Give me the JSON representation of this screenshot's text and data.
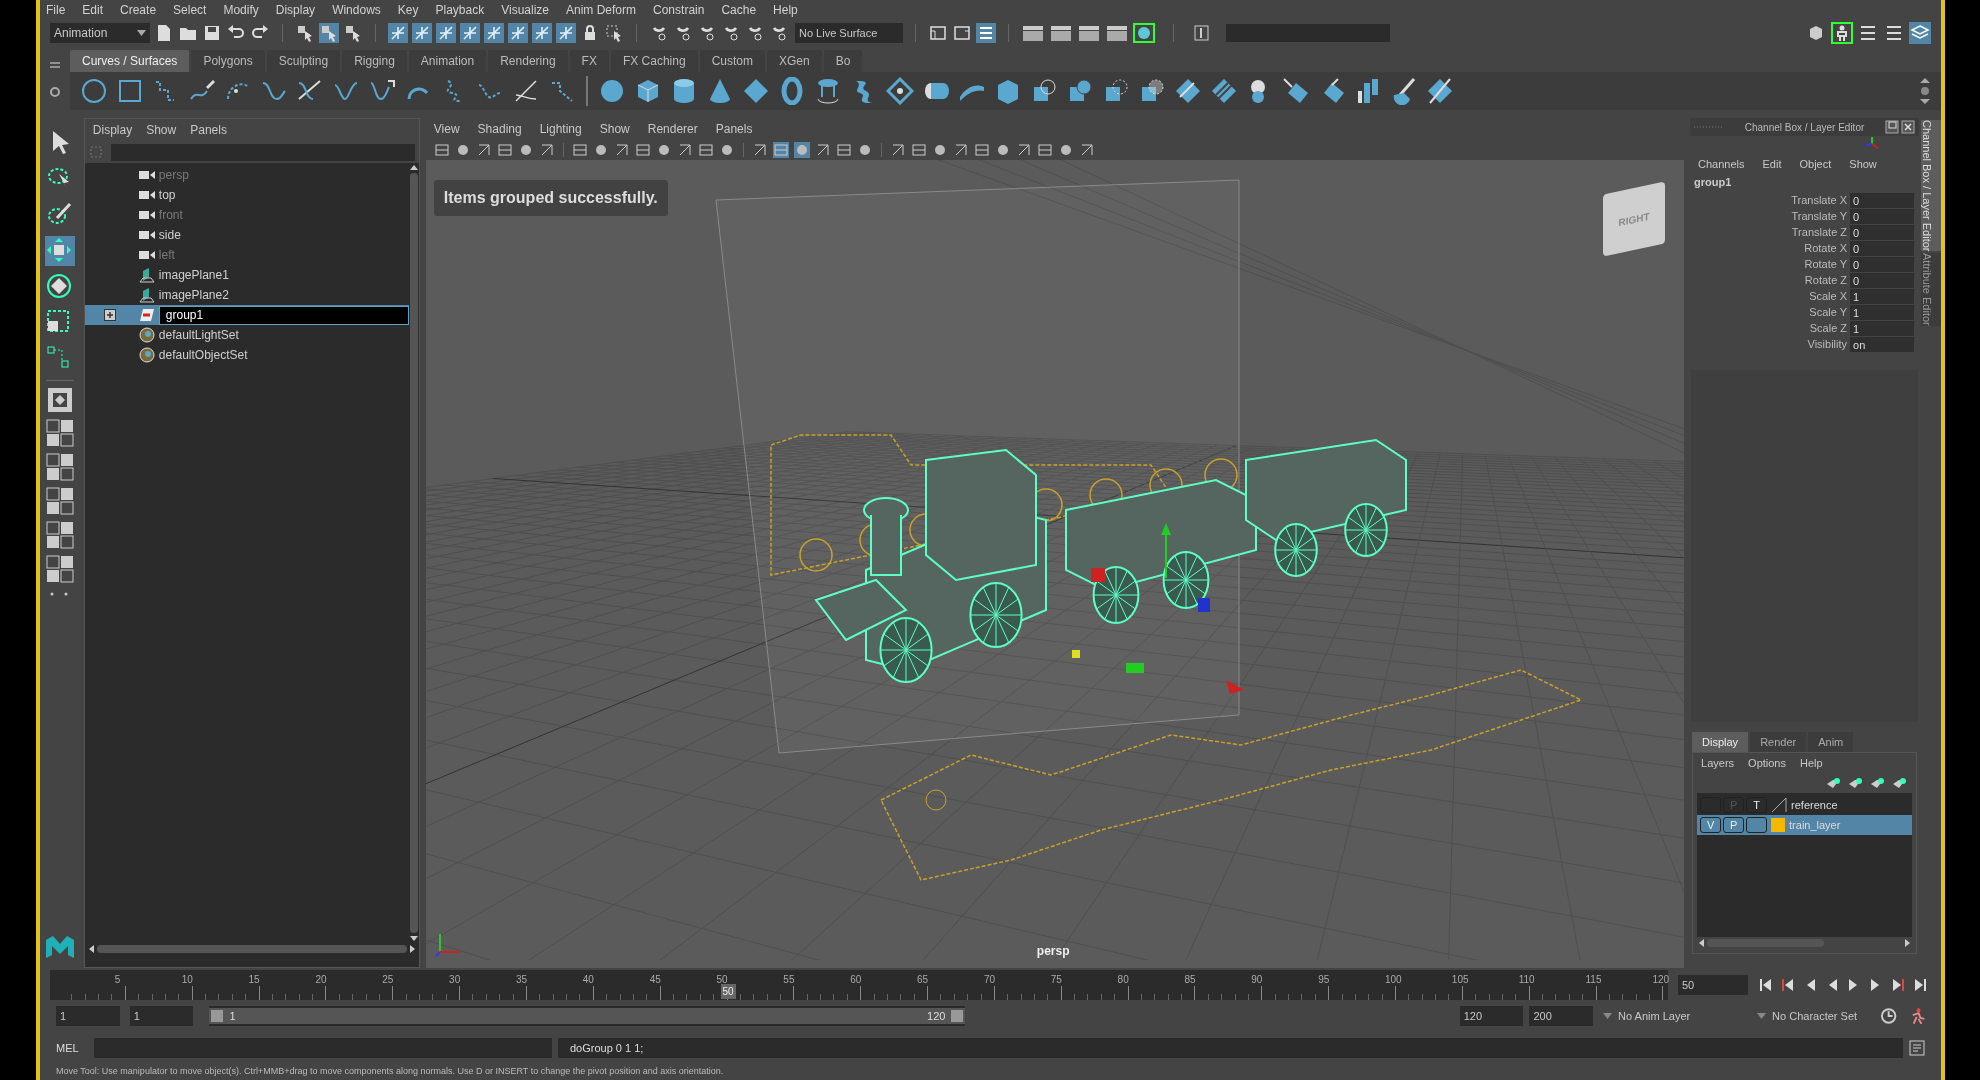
{
  "menu_bar": [
    "File",
    "Edit",
    "Create",
    "Select",
    "Modify",
    "Display",
    "Windows",
    "Key",
    "Playback",
    "Visualize",
    "Anim Deform",
    "Constrain",
    "Cache",
    "Help"
  ],
  "status_line": {
    "menu_set": "Animation",
    "live_surface": "No Live Surface"
  },
  "shelf_tabs": [
    {
      "label": "Curves / Surfaces",
      "selected": true
    },
    {
      "label": "Polygons",
      "selected": false
    },
    {
      "label": "Sculpting",
      "selected": false
    },
    {
      "label": "Rigging",
      "selected": false
    },
    {
      "label": "Animation",
      "selected": false
    },
    {
      "label": "Rendering",
      "selected": false
    },
    {
      "label": "FX",
      "selected": false
    },
    {
      "label": "FX Caching",
      "selected": false
    },
    {
      "label": "Custom",
      "selected": false
    },
    {
      "label": "XGen",
      "selected": false
    },
    {
      "label": "Bo",
      "selected": false
    }
  ],
  "outliner": {
    "menus": [
      "Display",
      "Show",
      "Panels"
    ],
    "items": [
      {
        "kind": "camera",
        "label": "persp",
        "hidden": true,
        "selected": false
      },
      {
        "kind": "camera",
        "label": "top",
        "hidden": false,
        "selected": false
      },
      {
        "kind": "camera",
        "label": "front",
        "hidden": true,
        "selected": false
      },
      {
        "kind": "camera",
        "label": "side",
        "hidden": false,
        "selected": false
      },
      {
        "kind": "camera",
        "label": "left",
        "hidden": true,
        "selected": false
      },
      {
        "kind": "image_plane",
        "label": "imagePlane1",
        "hidden": false,
        "selected": false
      },
      {
        "kind": "image_plane",
        "label": "imagePlane2",
        "hidden": false,
        "selected": false
      },
      {
        "kind": "group",
        "label": "group1",
        "hidden": false,
        "selected": true,
        "expanded": false
      },
      {
        "kind": "set",
        "label": "defaultLightSet",
        "hidden": false,
        "selected": false
      },
      {
        "kind": "set",
        "label": "defaultObjectSet",
        "hidden": false,
        "selected": false
      }
    ]
  },
  "viewport": {
    "menus": [
      "View",
      "Shading",
      "Lighting",
      "Show",
      "Renderer",
      "Panels"
    ],
    "message": "Items grouped successfully.",
    "view_cube": "RIGHT",
    "camera": "persp"
  },
  "channel_box": {
    "title": "Channel Box / Layer Editor",
    "menus": [
      "Channels",
      "Edit",
      "Object",
      "Show"
    ],
    "object": "group1",
    "channels": [
      {
        "name": "Translate X",
        "value": "0"
      },
      {
        "name": "Translate Y",
        "value": "0"
      },
      {
        "name": "Translate Z",
        "value": "0"
      },
      {
        "name": "Rotate X",
        "value": "0"
      },
      {
        "name": "Rotate Y",
        "value": "0"
      },
      {
        "name": "Rotate Z",
        "value": "0"
      },
      {
        "name": "Scale X",
        "value": "1"
      },
      {
        "name": "Scale Y",
        "value": "1"
      },
      {
        "name": "Scale Z",
        "value": "1"
      },
      {
        "name": "Visibility",
        "value": "on"
      }
    ]
  },
  "layer_editor": {
    "tabs": [
      {
        "label": "Display",
        "selected": true
      },
      {
        "label": "Render",
        "selected": false
      },
      {
        "label": "Anim",
        "selected": false
      }
    ],
    "menus": [
      "Layers",
      "Options",
      "Help"
    ],
    "layers": [
      {
        "name": "reference",
        "selected": false,
        "p_toggle": {
          "label": "P",
          "on": false
        },
        "t_toggle": {
          "label": "T",
          "on": true
        }
      },
      {
        "name": "train_layer",
        "selected": true,
        "color": "#f5b800",
        "v_toggle": {
          "label": "V",
          "on": true
        },
        "p_toggle": {
          "label": "P",
          "on": true
        }
      }
    ]
  },
  "side_tabs": [
    {
      "label": "Channel Box / Layer Editor",
      "selected": true
    },
    {
      "label": "Attribute Editor",
      "selected": false
    }
  ],
  "timeline": {
    "ticks": [
      "5",
      "10",
      "15",
      "20",
      "25",
      "30",
      "35",
      "40",
      "45",
      "50",
      "55",
      "60",
      "65",
      "70",
      "75",
      "80",
      "85",
      "90",
      "95",
      "100",
      "105",
      "110",
      "115",
      "120"
    ],
    "current": "50",
    "level": 0.4167,
    "current_field": "50"
  },
  "range": {
    "start": "1",
    "playback_start": "1",
    "slider_start": "1",
    "slider_end": "120",
    "playback_end": "120",
    "end": "200",
    "level": 1,
    "anim_layer": "No Anim Layer",
    "character_set": "No Character Set"
  },
  "command_line": {
    "language": "MEL",
    "result": "doGroup 0 1 1;"
  },
  "help_line": "Move Tool: Use manipulator to move object(s). Ctrl+MMB+drag to move components along normals. Use D or INSERT to change the pivot position and axis orientation."
}
